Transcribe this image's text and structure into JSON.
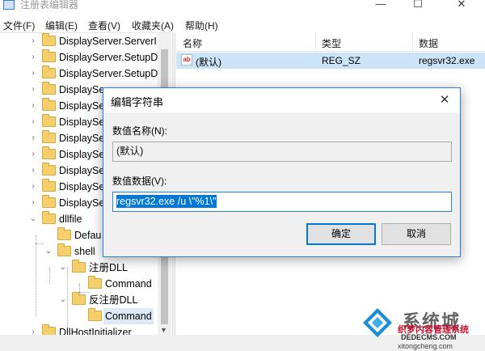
{
  "window": {
    "title": "注册表编辑器",
    "controls": {
      "minimize": "—",
      "maximize": "☐",
      "close": "✕"
    }
  },
  "menu": {
    "items": [
      "文件(F)",
      "编辑(E)",
      "查看(V)",
      "收藏夹(A)",
      "帮助(H)"
    ]
  },
  "tree": {
    "rows": [
      {
        "label": "DisplayServer.ServerI",
        "expander": "›",
        "selected": false
      },
      {
        "label": "DisplayServer.SetupD",
        "expander": "›",
        "selected": false
      },
      {
        "label": "DisplayServer.SetupD",
        "expander": "›",
        "selected": false
      },
      {
        "label": "DisplaySe",
        "expander": "›",
        "selected": false
      },
      {
        "label": "DisplaySe",
        "expander": "›",
        "selected": false
      },
      {
        "label": "DisplaySe",
        "expander": "›",
        "selected": false
      },
      {
        "label": "DisplaySe",
        "expander": "›",
        "selected": false
      },
      {
        "label": "DisplaySe",
        "expander": "›",
        "selected": false
      },
      {
        "label": "DisplaySe",
        "expander": "›",
        "selected": false
      },
      {
        "label": "DisplaySe",
        "expander": "›",
        "selected": false
      },
      {
        "label": "DisplaySe",
        "expander": "›",
        "selected": false
      },
      {
        "label": "dllfile",
        "expander": "⌄",
        "selected": false
      },
      {
        "label": "Defau",
        "expander": "",
        "selected": false
      },
      {
        "label": "shell",
        "expander": "⌄",
        "selected": false
      },
      {
        "label": "注册DLL",
        "expander": "⌄",
        "selected": false
      },
      {
        "label": "Command",
        "expander": "",
        "selected": false
      },
      {
        "label": "反注册DLL",
        "expander": "⌄",
        "selected": false
      },
      {
        "label": "Command",
        "expander": "",
        "selected": true
      },
      {
        "label": "DllHostInitializer",
        "expander": "›",
        "selected": false
      }
    ]
  },
  "list": {
    "headers": {
      "name": "名称",
      "type": "类型",
      "data": "数据"
    },
    "rows": [
      {
        "icon": "ab",
        "name": "(默认)",
        "type": "REG_SZ",
        "data": "regsvr32.exe"
      }
    ]
  },
  "dialog": {
    "title": "编辑字符串",
    "close": "✕",
    "value_name_label": "数值名称(N):",
    "value_name": "(默认)",
    "value_data_label": "数值数据(V):",
    "value_data": "regsvr32.exe /u \\\"%1\\\"",
    "ok_label": "确定",
    "cancel_label": "取消"
  },
  "watermark": {
    "brand": "系统城",
    "site": "织梦内容管理系统",
    "url": "DEDECMS.COM",
    "small": "xitongcheng.com"
  },
  "colors": {
    "accent": "#0078d7",
    "selection": "#cce4f7",
    "dialog_border": "#2b7fd4",
    "folder": "#f5cf6b"
  },
  "icons": {
    "app": "registry-icon",
    "folder": "folder-icon",
    "value": "reg-sz-icon",
    "close": "close-icon"
  }
}
